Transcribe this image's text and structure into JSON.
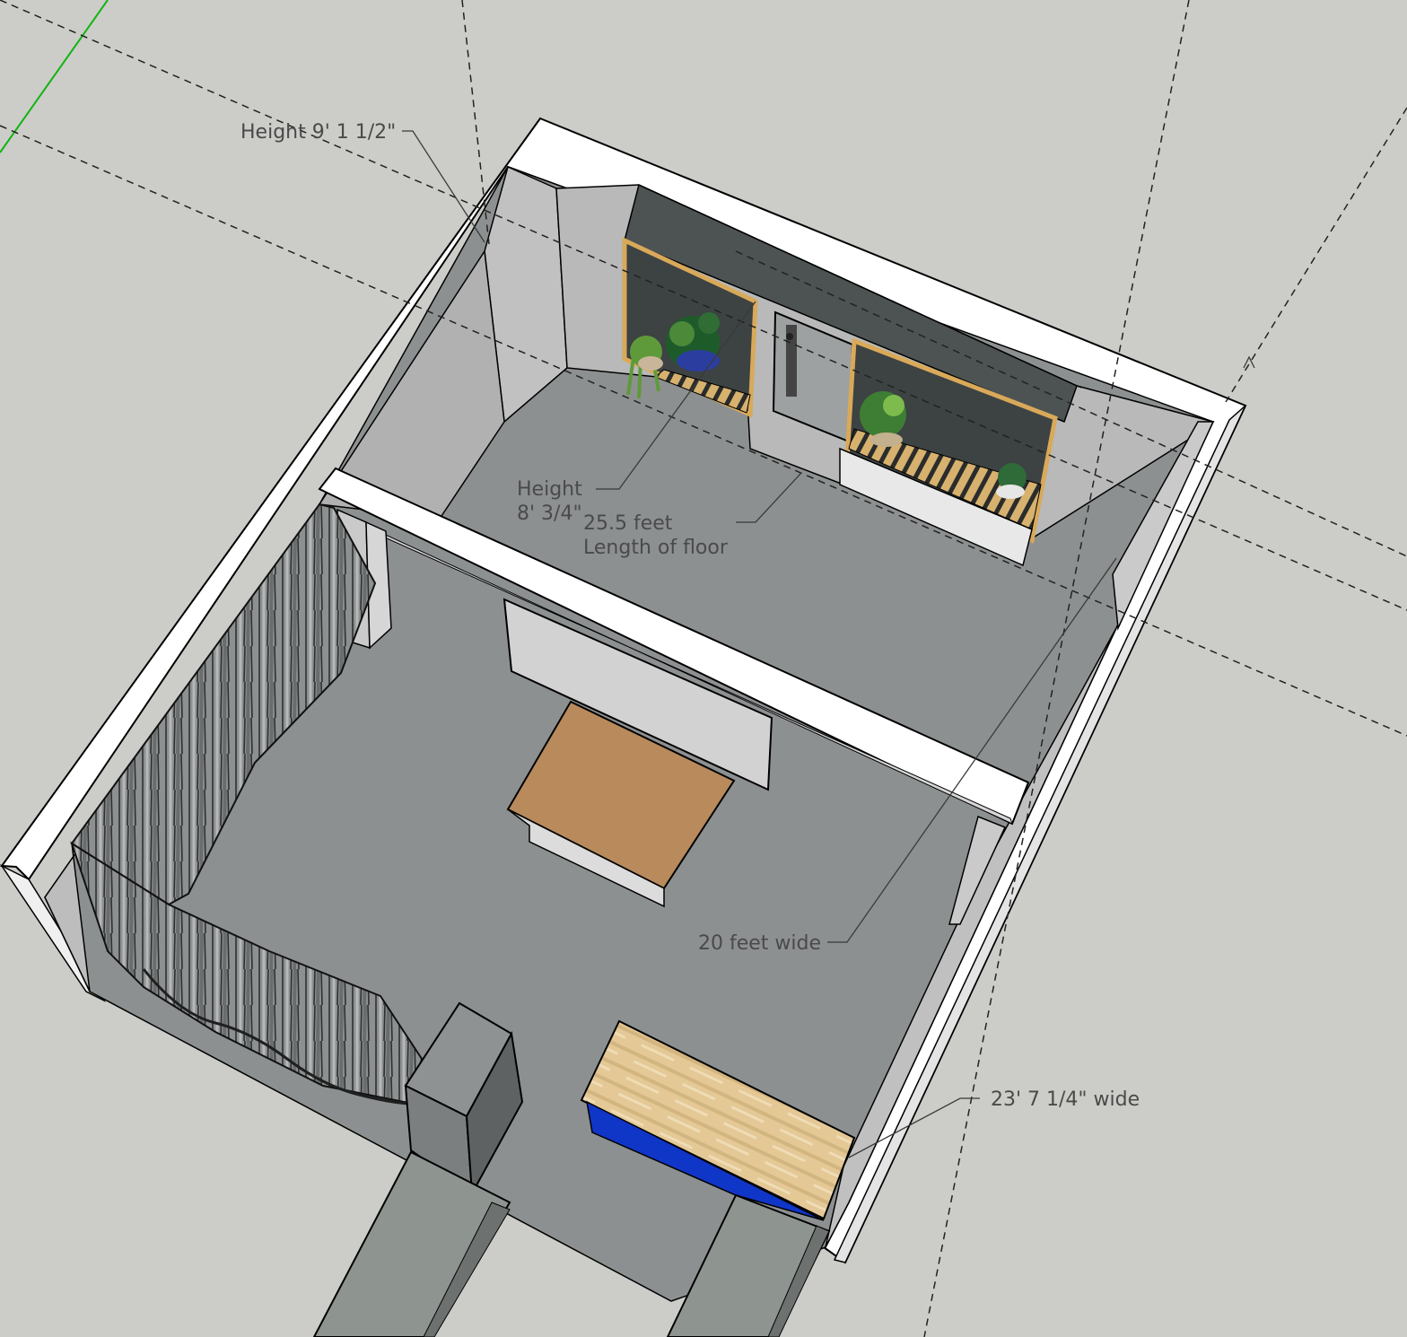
{
  "dimensions": {
    "height_rear": "Height 9' 1 1/2\"",
    "height_mid_line1": "Height",
    "height_mid_line2": "8' 3/4\"",
    "length_line1": "25.5 feet",
    "length_line2": "Length of floor",
    "width_inner": "20 feet wide",
    "width_outer": "23' 7 1/4\" wide"
  },
  "colors": {
    "background": "#cccdc8",
    "wall_top": "#ffffff",
    "wall_inner": "#c4c5c4",
    "floor": "#8c8f90",
    "axis_green": "#11b411",
    "desk_top": "#b88a5c",
    "bench_wood": "#e3c995",
    "bench_blue": "#1036c8",
    "window_frame": "#d9a95a",
    "header_beam": "#4d5353",
    "dim_text": "#4a4a4a"
  }
}
